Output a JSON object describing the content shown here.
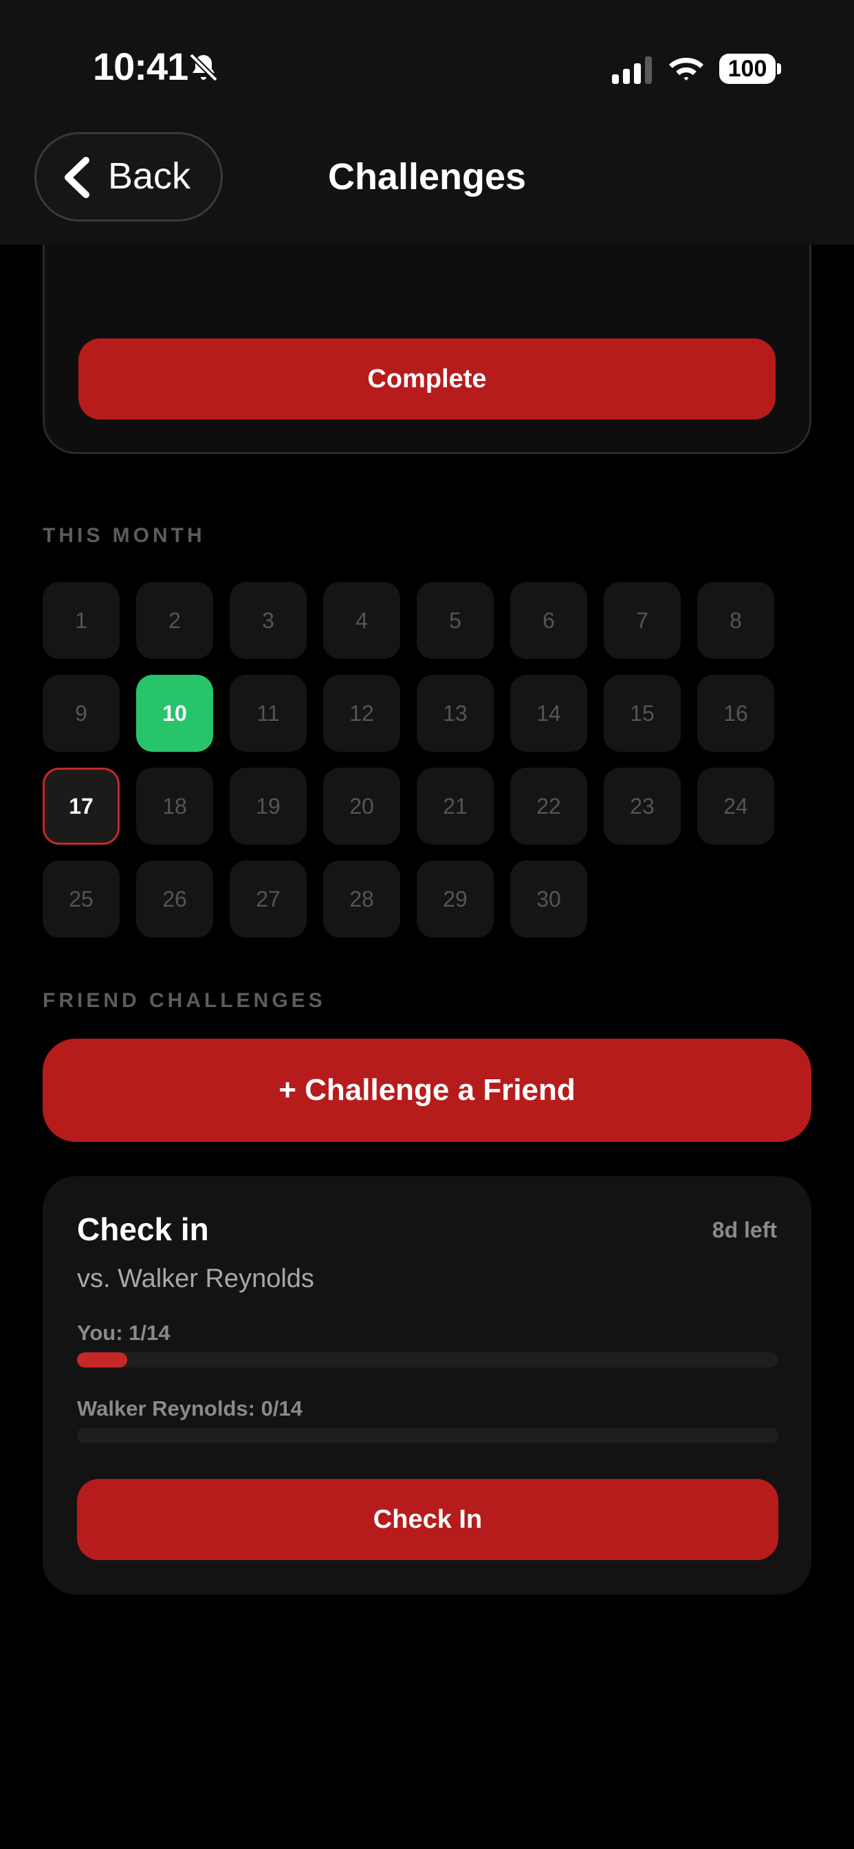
{
  "status_bar": {
    "time": "10:41",
    "battery": "100",
    "icons": [
      "bell-slash-icon",
      "cellular-signal-icon",
      "wifi-icon",
      "battery-icon"
    ]
  },
  "header": {
    "back_label": "Back",
    "title": "Challenges"
  },
  "top_card": {
    "complete_label": "Complete"
  },
  "month": {
    "section_label": "THIS MONTH",
    "days": [
      "1",
      "2",
      "3",
      "4",
      "5",
      "6",
      "7",
      "8",
      "9",
      "10",
      "11",
      "12",
      "13",
      "14",
      "15",
      "16",
      "17",
      "18",
      "19",
      "20",
      "21",
      "22",
      "23",
      "24",
      "25",
      "26",
      "27",
      "28",
      "29",
      "30"
    ],
    "completed_days": [
      "10"
    ],
    "today": "17"
  },
  "friends": {
    "section_label": "FRIEND CHALLENGES",
    "challenge_button_label": "+ Challenge a Friend",
    "challenge": {
      "title": "Check in",
      "time_left": "8d left",
      "opponent": "vs. Walker Reynolds",
      "you_label": "You: 1/14",
      "you_progress": 0.0714,
      "opponent_label": "Walker Reynolds: 0/14",
      "opponent_progress": 0,
      "check_in_label": "Check In"
    }
  },
  "colors": {
    "accent_red": "#b71c1c",
    "completed_green": "#27c46a",
    "background": "#000000"
  }
}
